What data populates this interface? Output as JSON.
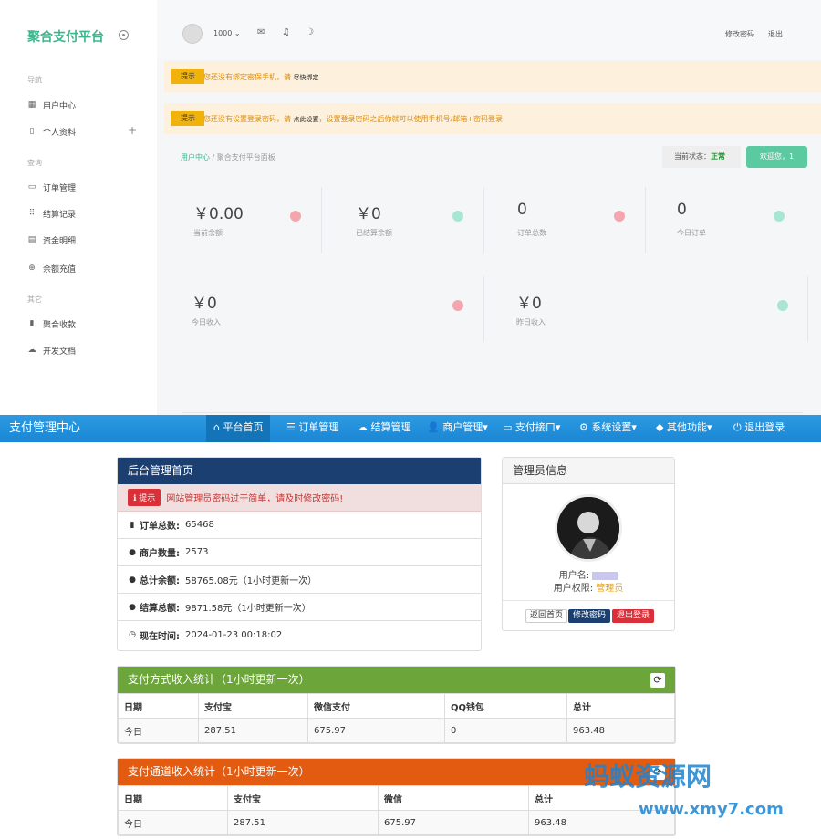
{
  "merchant": {
    "brand": "聚合支付平台",
    "sections": [
      "导航",
      "查询",
      "其它"
    ],
    "sidebar": [
      {
        "label": "用户中心",
        "icon": "grid-icon"
      },
      {
        "label": "个人资料",
        "icon": "bookmark-icon"
      },
      {
        "label": "订单管理",
        "icon": "monitor-icon"
      },
      {
        "label": "结算记录",
        "icon": "dots-grid-icon"
      },
      {
        "label": "资金明细",
        "icon": "calendar-icon"
      },
      {
        "label": "余额充值",
        "icon": "plus-circle-icon"
      },
      {
        "label": "聚合收款",
        "icon": "bar-chart-icon"
      },
      {
        "label": "开发文档",
        "icon": "cloud-icon"
      }
    ],
    "header": {
      "user": "1000",
      "change_password": "修改密码",
      "logout": "退出"
    },
    "alerts": [
      {
        "tag": "提示",
        "msg": "您还没有绑定密保手机，请",
        "link": "尽快绑定",
        "tail": ""
      },
      {
        "tag": "提示",
        "msg": "您还没有设置登录密码，请",
        "link": "点此设置",
        "tail": "，设置登录密码之后你就可以使用手机号/邮箱+密码登录"
      }
    ],
    "breadcrumb": {
      "home": "用户中心",
      "current": "聚合支付平台面板"
    },
    "status_label": "当前状态：",
    "status_value": "正常",
    "welcome": "欢迎您，1",
    "stats": [
      {
        "value": "￥0.00",
        "label": "当前余额",
        "color": "#f5a5ad"
      },
      {
        "value": "￥0",
        "label": "已结算余额",
        "color": "#a8e6d2"
      },
      {
        "value": "0",
        "label": "订单总数",
        "color": "#f5a5ad"
      },
      {
        "value": "0",
        "label": "今日订单",
        "color": "#a8e6d2"
      },
      {
        "value": "￥0",
        "label": "今日收入",
        "color": "#f5a5ad"
      },
      {
        "value": "￥0",
        "label": "昨日收入",
        "color": "#a8e6d2"
      }
    ]
  },
  "admin": {
    "brand": "支付管理中心",
    "nav": [
      {
        "label": "平台首页",
        "icon": "home-icon"
      },
      {
        "label": "订单管理",
        "icon": "list-icon"
      },
      {
        "label": "结算管理",
        "icon": "cloud-icon"
      },
      {
        "label": "商户管理▾",
        "icon": "user-icon"
      },
      {
        "label": "支付接口▾",
        "icon": "credit-card-icon"
      },
      {
        "label": "系统设置▾",
        "icon": "gear-icon"
      },
      {
        "label": "其他功能▾",
        "icon": "cube-icon"
      },
      {
        "label": "退出登录",
        "icon": "power-icon"
      }
    ],
    "home_panel": {
      "title": "后台管理首页",
      "warn_badge": "提示",
      "warn_text": "网站管理员密码过于简单，请及时修改密码!",
      "rows": [
        {
          "key": "订单总数:",
          "value": "65468"
        },
        {
          "key": "商户数量:",
          "value": "2573"
        },
        {
          "key": "总计余额:",
          "value": "58765.08元（1小时更新一次）"
        },
        {
          "key": "结算总额:",
          "value": "9871.58元（1小时更新一次）"
        },
        {
          "key": "现在时间:",
          "value": "2024-01-23 00:18:02"
        }
      ]
    },
    "admin_panel": {
      "title": "管理员信息",
      "username_label": "用户名:",
      "role_label": "用户权限:",
      "role_value": "管理员",
      "btn_home": "返回首页",
      "btn_pwd": "修改密码",
      "btn_logout": "退出登录"
    },
    "pay_method": {
      "title": "支付方式收入统计（1小时更新一次）",
      "headers": [
        "日期",
        "支付宝",
        "微信支付",
        "QQ钱包",
        "总计"
      ],
      "rows": [
        [
          "今日",
          "287.51",
          "675.97",
          "0",
          "963.48"
        ]
      ]
    },
    "pay_channel": {
      "title": "支付通道收入统计（1小时更新一次）",
      "headers": [
        "日期",
        "支付宝",
        "微信",
        "总计"
      ],
      "rows": [
        [
          "今日",
          "287.51",
          "675.97",
          "963.48"
        ]
      ]
    },
    "watermark": {
      "main": "蚂蚁资源网",
      "sub": "www.xmy7.com"
    }
  }
}
